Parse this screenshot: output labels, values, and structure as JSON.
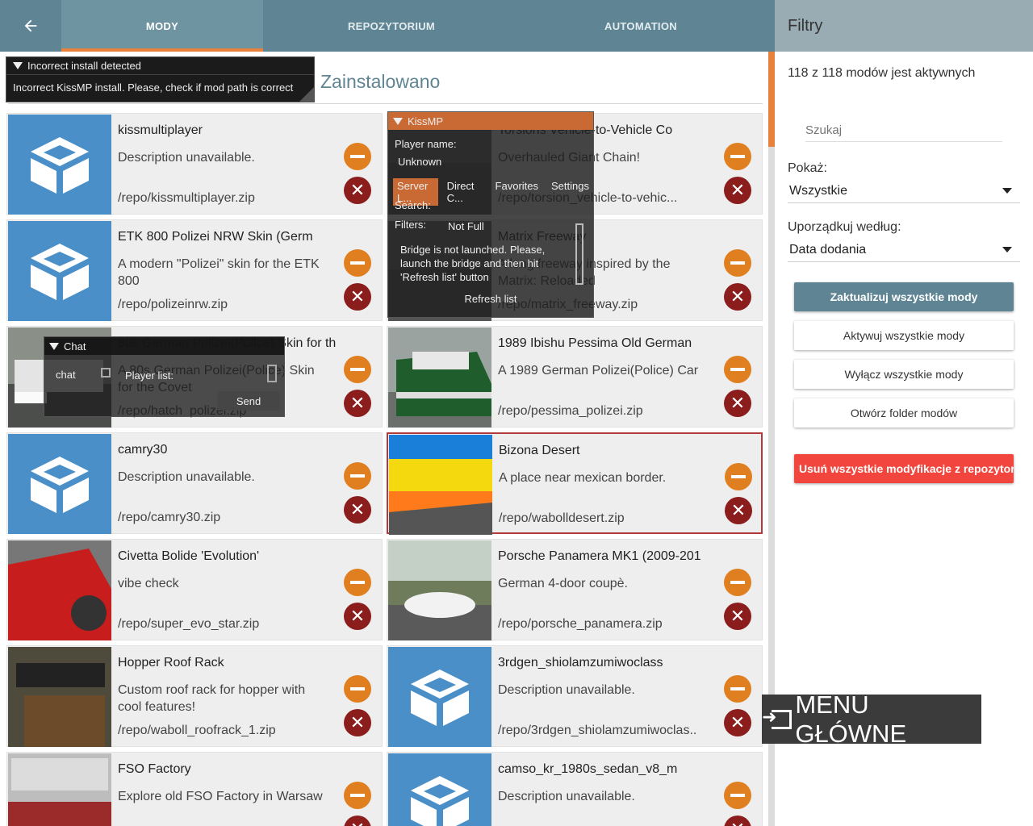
{
  "topbar": {
    "back_icon": "arrow-left-icon",
    "tabs": [
      {
        "label": "MODY",
        "active": true
      },
      {
        "label": "REPOZYTORIUM",
        "active": false
      },
      {
        "label": "AUTOMATION",
        "active": false
      }
    ]
  },
  "main": {
    "section_title": "Zainstalowano",
    "mods": [
      {
        "title": "kissmultiplayer",
        "desc": "Description unavailable.",
        "path": "/repo/kissmultiplayer.zip",
        "thumb": "box"
      },
      {
        "title": "Torsions Vehicle-to-Vehicle Co",
        "desc": "Overhauled Giant Chain!",
        "path": "/repo/torsion_vehicle-to-vehic...",
        "thumb": "photo-dark"
      },
      {
        "title": "ETK 800 Polizei NRW Skin (Germ",
        "desc": "A modern \"Polizei\" skin for the ETK 800",
        "path": "/repo/polizeinrw.zip",
        "thumb": "box"
      },
      {
        "title": "Matrix Freeway",
        "desc": "A long freeway inspired by the Matrix: Reloaded",
        "path": "/repo/matrix_freeway.zip",
        "thumb": "photo-dark"
      },
      {
        "title": "80s German Polizei(Police) Skin for the Covet",
        "desc": "A 80s German Polizei(Police) Skin for the Covet",
        "path": "/repo/hatch_polizei.zip",
        "thumb": "police-car"
      },
      {
        "title": "1989 Ibishu Pessima Old German",
        "desc": "A 1989 German Polizei(Police) Car",
        "path": "/repo/pessima_polizei.zip",
        "thumb": "police-car-green"
      },
      {
        "title": "camry30",
        "desc": "Description unavailable.",
        "path": "/repo/camry30.zip",
        "thumb": "box"
      },
      {
        "title": "Bizona Desert",
        "desc": "A place near mexican border.",
        "path": "/repo/wabolldesert.zip",
        "thumb": "bizona",
        "selected": true
      },
      {
        "title": "Civetta Bolide 'Evolution'",
        "desc": "vibe check",
        "path": "/repo/super_evo_star.zip",
        "thumb": "red-car"
      },
      {
        "title": "Porsche Panamera MK1 (2009-201",
        "desc": "German 4-door coupè.",
        "path": "/repo/porsche_panamera.zip",
        "thumb": "white-car"
      },
      {
        "title": "Hopper Roof Rack",
        "desc": "Custom roof rack for hopper with cool features!",
        "path": "/repo/waboll_roofrack_1.zip",
        "thumb": "roofrack"
      },
      {
        "title": "3rdgen_shiolamzumiwoclass",
        "desc": "Description unavailable.",
        "path": "/repo/3rdgen_shiolamzumiwoclas..",
        "thumb": "box"
      },
      {
        "title": "FSO Factory",
        "desc": "Explore old FSO Factory in Warsaw",
        "path": "",
        "thumb": "fso"
      },
      {
        "title": "camso_kr_1980s_sedan_v8_m",
        "desc": "Description unavailable.",
        "path": "",
        "thumb": "box"
      }
    ]
  },
  "filters": {
    "title": "Filtry",
    "active_count": "118 z 118 modów jest aktywnych",
    "search_placeholder": "Szukaj",
    "show_label": "Pokaż:",
    "show_value": "Wszystkie",
    "sort_label": "Uporządkuj według:",
    "sort_value": "Data dodania",
    "btn_update_all": "Zaktualizuj wszystkie mody",
    "btn_activate_all": "Aktywuj wszystkie mody",
    "btn_disable_all": "Wyłącz wszystkie mody",
    "btn_open_folder": "Otwórz folder modów",
    "btn_remove_repo": "Usuń wszystkie modyfikacje z repozytorium"
  },
  "overlay_error": {
    "title": "Incorrect install detected",
    "message": "Incorrect KissMP install. Please, check if mod path is correct"
  },
  "overlay_kissmp": {
    "title": "KissMP",
    "player_name_label": "Player name:",
    "player_name": "Unknown",
    "tabs": [
      "Server L...",
      "Direct C...",
      "Favorites",
      "Settings"
    ],
    "search_label": "Search:",
    "filters_label": "Filters:",
    "filters_value": "Not Full",
    "message": "Bridge is not launched. Please, launch the bridge and then hit 'Refresh list' button",
    "refresh": "Refresh list"
  },
  "overlay_chat": {
    "title": "Chat",
    "chat_label": "chat",
    "player_list_label": "Player list:",
    "send": "Send"
  },
  "menu_button": "MENU GŁÓWNE",
  "colors": {
    "topbar": "#5f8594",
    "accent": "#e8813c",
    "disable": "#e07f1f",
    "delete": "#8b1d1d",
    "danger": "#f2453d"
  }
}
